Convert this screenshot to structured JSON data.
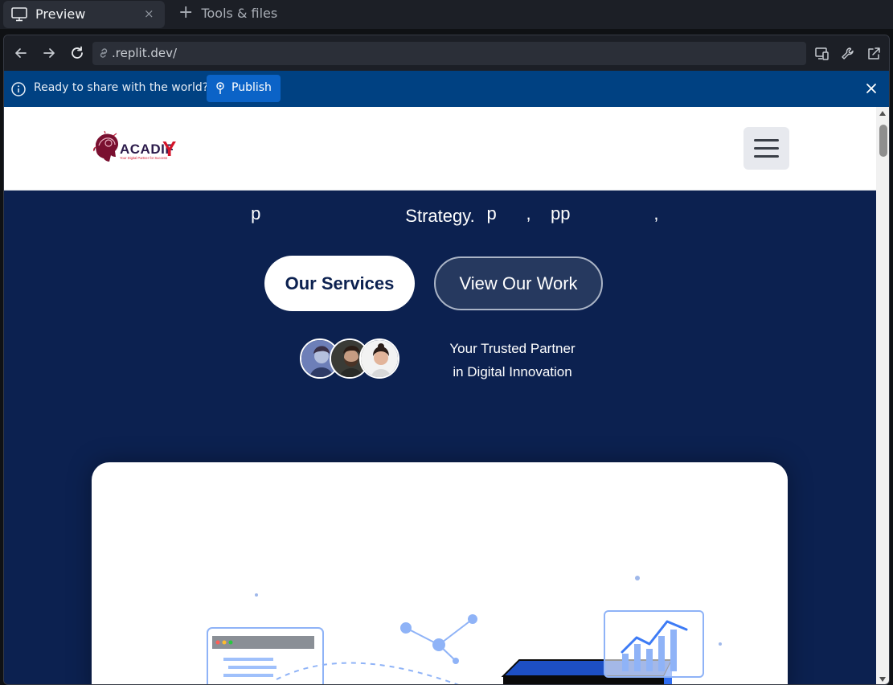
{
  "ide": {
    "tab_preview_label": "Preview",
    "tab_close_glyph": "×",
    "tools_label": "Tools & files",
    "url": ".replit.dev/",
    "banner_message": "Ready to share with the world?",
    "publish_label": "Publish"
  },
  "site": {
    "logo_text": "ACADIFY",
    "logo_tagline": "Your Digital Partner for Success",
    "hero_partial_line": "p                                              p      ,    pp                 ,",
    "hero_line_end": "Strategy.",
    "services_button": "Our Services",
    "work_button": "View Our Work",
    "trusted_line1": "Your Trusted Partner",
    "trusted_line2": "in Digital Innovation"
  },
  "colors": {
    "site_bg": "#0c2150",
    "banner": "#004182",
    "publish": "#0b63c7",
    "accent_blue": "#3d7bf5"
  }
}
